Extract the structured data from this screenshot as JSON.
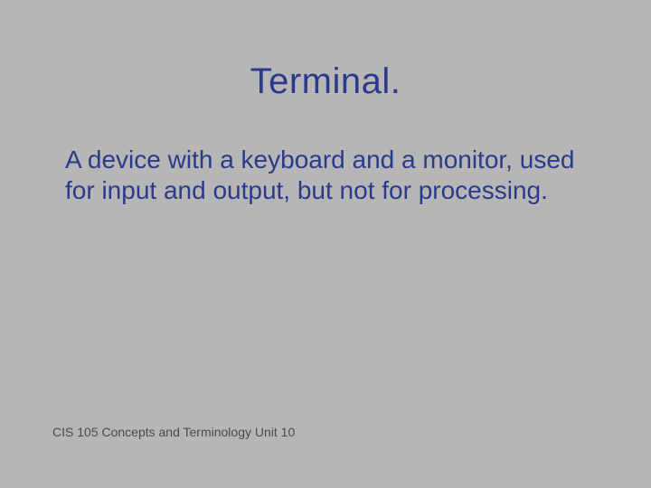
{
  "slide": {
    "title": "Terminal.",
    "body": "A device with a keyboard and a monitor, used for input and output, but not for processing.",
    "footer": "CIS 105 Concepts and Terminology  Unit 10"
  }
}
